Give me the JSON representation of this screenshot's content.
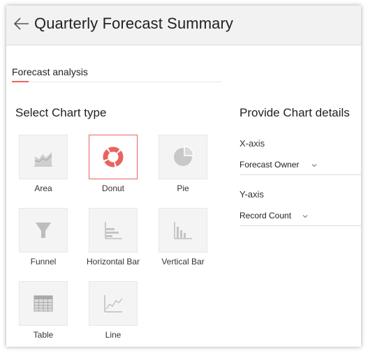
{
  "header": {
    "title": "Quarterly Forecast Summary"
  },
  "tabs": {
    "active_label": "Forecast analysis"
  },
  "left": {
    "heading": "Select Chart type",
    "chart_types": [
      {
        "label": "Area",
        "icon": "area-chart-icon",
        "selected": false
      },
      {
        "label": "Donut",
        "icon": "donut-chart-icon",
        "selected": true
      },
      {
        "label": "Pie",
        "icon": "pie-chart-icon",
        "selected": false
      },
      {
        "label": "Funnel",
        "icon": "funnel-chart-icon",
        "selected": false
      },
      {
        "label": "Horizontal Bar",
        "icon": "horizontal-bar-chart-icon",
        "selected": false
      },
      {
        "label": "Vertical Bar",
        "icon": "vertical-bar-chart-icon",
        "selected": false
      },
      {
        "label": "Table",
        "icon": "table-icon",
        "selected": false
      },
      {
        "label": "Line",
        "icon": "line-chart-icon",
        "selected": false
      }
    ]
  },
  "right": {
    "heading": "Provide Chart details",
    "x_axis": {
      "label": "X-axis",
      "value": "Forecast Owner"
    },
    "y_axis": {
      "label": "Y-axis",
      "value": "Record Count"
    }
  },
  "colors": {
    "accent": "#e8645f",
    "icon_gray": "#bdbdbd",
    "tile_bg": "#f4f4f4",
    "header_bg": "#f2f2f2"
  }
}
